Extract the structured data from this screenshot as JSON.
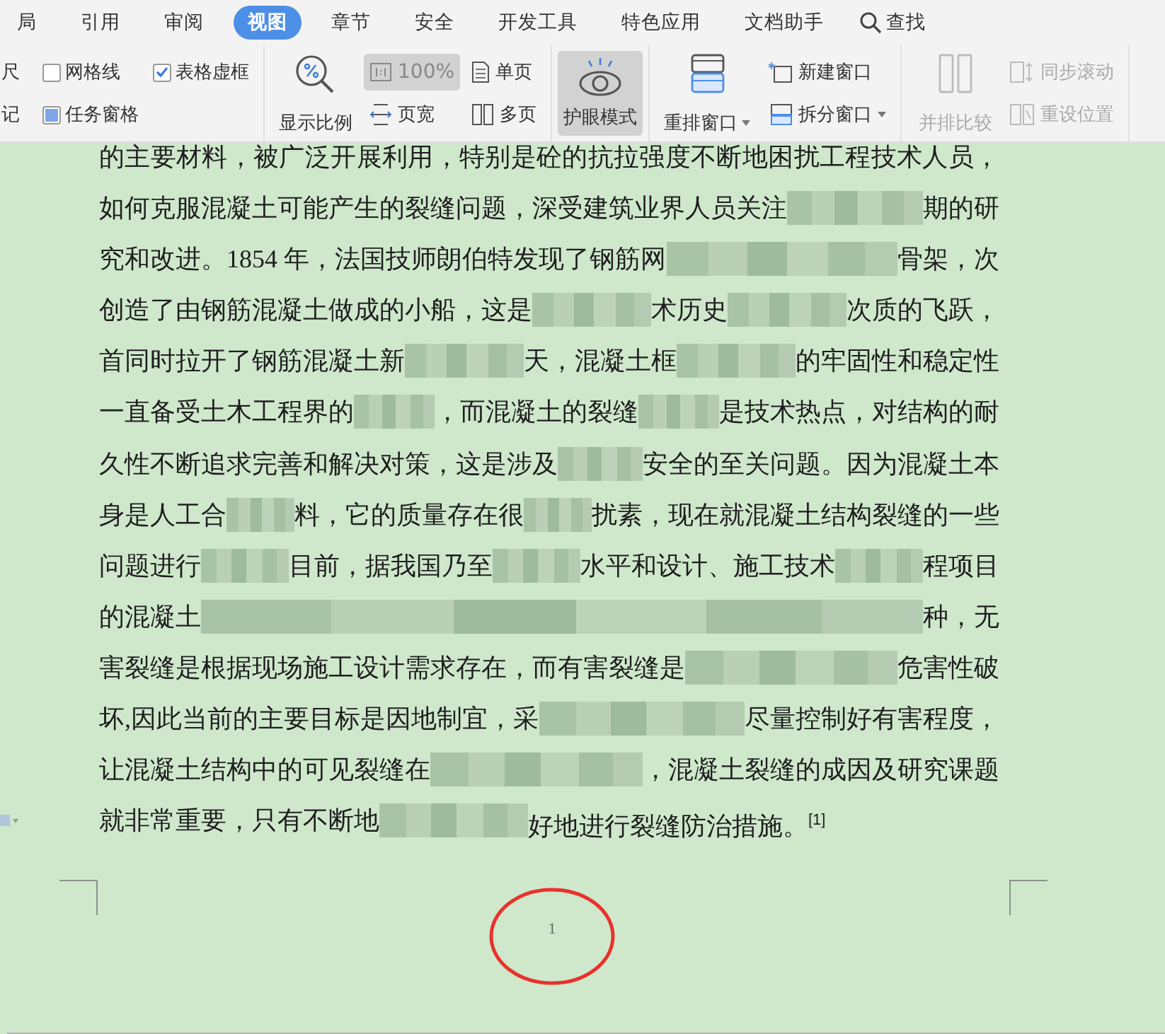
{
  "ribbon_tabs": [
    {
      "label": "局",
      "selected": false
    },
    {
      "label": "引用",
      "selected": false
    },
    {
      "label": "审阅",
      "selected": false
    },
    {
      "label": "视图",
      "selected": true
    },
    {
      "label": "章节",
      "selected": false
    },
    {
      "label": "安全",
      "selected": false
    },
    {
      "label": "开发工具",
      "selected": false
    },
    {
      "label": "特色应用",
      "selected": false
    },
    {
      "label": "文档助手",
      "selected": false
    }
  ],
  "search": {
    "label": "查找"
  },
  "view_options": [
    {
      "kind": "label",
      "label": "尺"
    },
    {
      "kind": "checkbox",
      "label": "网格线",
      "checked": false
    },
    {
      "kind": "checkbox",
      "label": "表格虚框",
      "checked": true
    },
    {
      "kind": "label",
      "label": "记"
    },
    {
      "kind": "toggle",
      "label": "任务窗格",
      "checked": true
    }
  ],
  "zoom_group": {
    "zoom_button": {
      "label": "显示比例"
    },
    "zoom_100": {
      "label": "100%",
      "pressed": true
    },
    "page_width": {
      "label": "页宽"
    },
    "single_page": {
      "label": "单页"
    },
    "multi_page": {
      "label": "多页"
    }
  },
  "eye_mode": {
    "label": "护眼模式",
    "pressed": true
  },
  "window_group": {
    "arrange": {
      "label": "重排窗口"
    },
    "new_window": {
      "label": "新建窗口"
    },
    "split_window": {
      "label": "拆分窗口"
    }
  },
  "compare_group": {
    "side_by_side": {
      "label": "并排比较",
      "disabled": true
    },
    "sync_scroll": {
      "label": "同步滚动",
      "disabled": true
    },
    "reset_position": {
      "label": "重设位置",
      "disabled": true
    }
  },
  "document": {
    "lines": [
      {
        "parts": [
          "的主要材料，被广泛开展利用，特别是砼的抗拉强度不断地困扰工程技术人员，"
        ]
      },
      {
        "parts": [
          "如何克服混凝土可能产生的裂缝问题，深受建筑业界人员关注",
          "期的研"
        ]
      },
      {
        "parts": [
          "究和改进。1854 年，法国技师朗伯特发现了钢筋网",
          "骨架，次"
        ]
      },
      {
        "parts": [
          "创造了由钢筋混凝土做成的小船，这是",
          "术历史",
          "次质的飞跃，"
        ]
      },
      {
        "parts": [
          "首同时拉开了钢筋混凝土新",
          "天，混凝土框",
          "的牢固性和稳定性"
        ]
      },
      {
        "parts": [
          "一直备受土木工程界的",
          "，而混凝土的裂缝",
          "是技术热点，对结构的耐"
        ]
      },
      {
        "parts": [
          "久性不断追求完善和解决对策，这是涉及",
          "安全的至关问题。因为混凝土本"
        ]
      },
      {
        "parts": [
          "身是人工合",
          "料，它的质量存在很",
          "扰素，现在就混凝土结构裂缝的一些"
        ]
      },
      {
        "parts": [
          "问题进行",
          "目前，据我国乃至",
          "水平和设计、施工技术",
          "程项目"
        ]
      },
      {
        "parts": [
          "的混凝土",
          "种，无"
        ]
      },
      {
        "parts": [
          "害裂缝是根据现场施工设计需求存在，而有害裂缝是",
          "危害性破"
        ]
      },
      {
        "parts": [
          "坏,因此当前的主要目标是因地制宜，采",
          "尽量控制好有害程度，"
        ]
      },
      {
        "parts": [
          "让混凝土结构中的可见裂缝在",
          "，混凝土裂缝的成因及研究课题"
        ]
      },
      {
        "parts": [
          "就非常重要，只有不断地",
          "好地进行裂缝防治措施。$^{[1]}$"
        ]
      }
    ],
    "page_number": "1"
  }
}
